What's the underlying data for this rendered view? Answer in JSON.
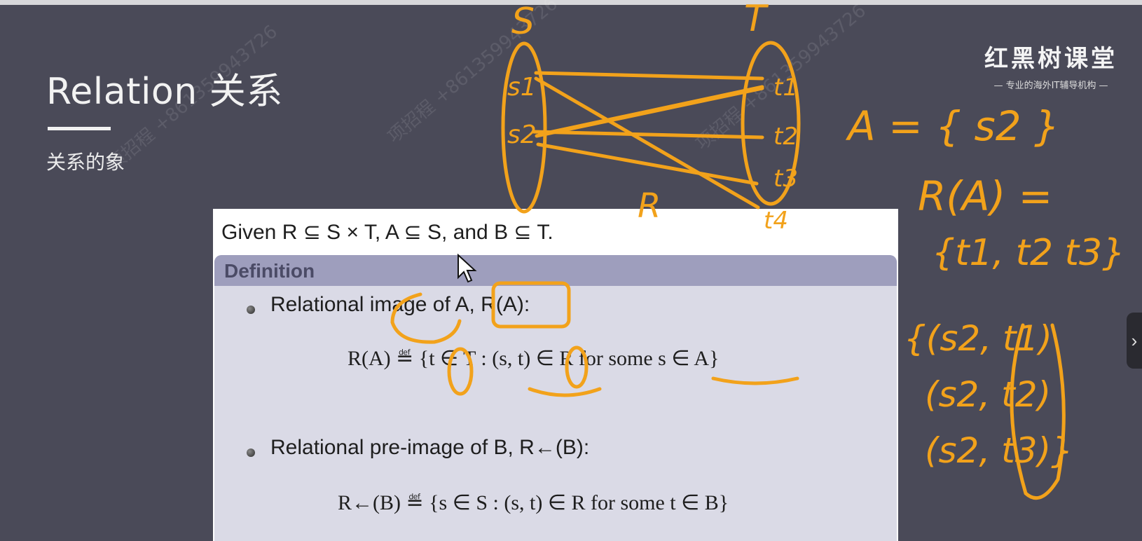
{
  "slide": {
    "title": "Relation 关系",
    "subtitle": "关系的象"
  },
  "logo": {
    "name": "红黑树课堂",
    "tagline": "— 专业的海外IT辅导机构 —"
  },
  "watermarks": [
    "项招程 +861359943726",
    "项招程 +861359943726",
    "项招程 +861359943726"
  ],
  "card": {
    "given": "Given R ⊆ S × T, A ⊆ S, and B ⊆ T.",
    "definition_header": "Definition",
    "item1_label": "Relational image of A, R(A):",
    "item1_formula": "R(A) ≝ {t ∈ T : (s, t) ∈ R for some s ∈ A}",
    "item2_label": "Relational pre-image of B, R←(B):",
    "item2_formula": "R←(B) ≝ {s ∈ S : (s, t) ∈ R for some t ∈ B}"
  },
  "handwriting": {
    "set_s": "S",
    "set_t": "T",
    "s1": "s1",
    "s2": "s2",
    "t1": "t1",
    "t2": "t2",
    "t3": "t3",
    "t4": "t4",
    "relation": "R",
    "note_a": "A = { s2 }",
    "note_ra": "R(A) =",
    "note_ra_set": "{t1, t2 t3}",
    "pair1": "{(s2, t1)",
    "pair2": "(s2, t2)",
    "pair3": "(s2, t3)}",
    "ink_color": "#f2a21b"
  },
  "side_tab": "›"
}
